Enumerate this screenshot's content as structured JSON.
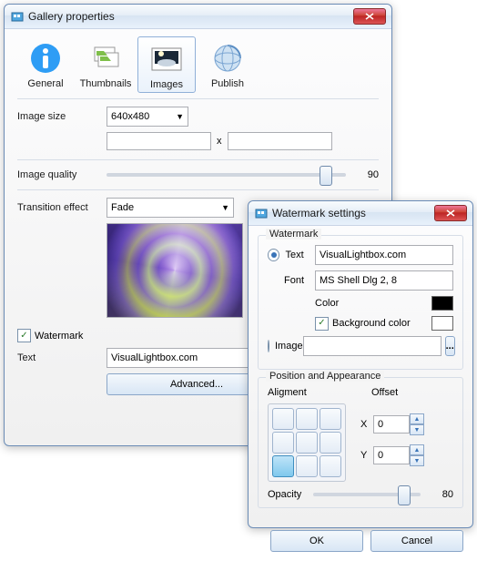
{
  "gallery": {
    "title": "Gallery properties",
    "tabs": [
      {
        "label": "General",
        "icon": "info-icon"
      },
      {
        "label": "Thumbnails",
        "icon": "thumbnails-icon"
      },
      {
        "label": "Images",
        "icon": "images-icon"
      },
      {
        "label": "Publish",
        "icon": "publish-icon"
      }
    ],
    "active_tab": 2,
    "image_size": {
      "label": "Image size",
      "value": "640x480",
      "width": "",
      "height": "",
      "separator": "x"
    },
    "image_quality": {
      "label": "Image quality",
      "value": 90
    },
    "transition": {
      "label": "Transition effect",
      "value": "Fade"
    },
    "watermark": {
      "label": "Watermark",
      "checked": true
    },
    "text": {
      "label": "Text",
      "value": "VisualLightbox.com"
    },
    "advanced_btn": "Advanced..."
  },
  "watermark_dlg": {
    "title": "Watermark settings",
    "group1": "Watermark",
    "text_radio": {
      "label": "Text",
      "checked": true,
      "value": "VisualLightbox.com"
    },
    "font": {
      "label": "Font",
      "value": "MS Shell Dlg 2, 8"
    },
    "color": {
      "label": "Color",
      "value": "#000000"
    },
    "bgcolor": {
      "label": "Background color",
      "checked": true,
      "value": ""
    },
    "image_radio": {
      "label": "Image",
      "checked": false,
      "value": ""
    },
    "browse": "...",
    "group2": "Position and Appearance",
    "alignment_label": "Aligment",
    "alignment_selected": 6,
    "offset_label": "Offset",
    "offset_x": {
      "label": "X",
      "value": 0
    },
    "offset_y": {
      "label": "Y",
      "value": 0
    },
    "opacity": {
      "label": "Opacity",
      "value": 80
    },
    "ok": "OK",
    "cancel": "Cancel"
  }
}
